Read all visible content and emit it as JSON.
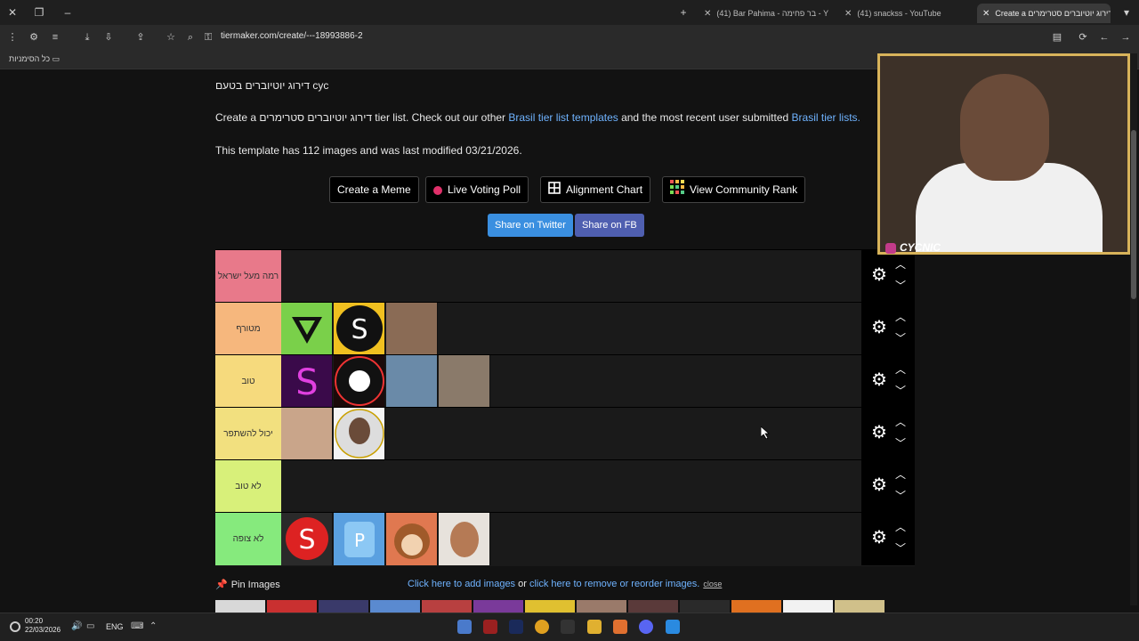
{
  "browser": {
    "tabs": [
      {
        "label": "(41) Bar Pahima - בר פחימה - Y",
        "active": false
      },
      {
        "label": "(41) snackss - YouTube",
        "active": false
      },
      {
        "label": "Create a דירוג יוטיוברים סטרימרים",
        "active": true
      }
    ],
    "url": "tiermaker.com/create/---18993886-2",
    "bookmarks_label": "כל הסימניות"
  },
  "page": {
    "title": "דירוג יוטיוברים בטעם cyc",
    "intro": {
      "prefix": "Create a דירוג יוטיוברים סטרימרים tier list. Check out our other ",
      "link1": "Brasil tier list templates",
      "middle": " and the most recent user submitted ",
      "link2": "Brasil tier lists."
    },
    "template_info": "This template has 112 images and was last modified 03/21/2026.",
    "buttons": {
      "meme": "Create a Meme",
      "poll": "Live Voting Poll",
      "alignment": "Alignment Chart",
      "community": "View Community Rank",
      "twitter": "Share on Twitter",
      "fb": "Share on FB"
    },
    "tiers": [
      {
        "label": "רמה מעל ישראל",
        "color": "#e8798a",
        "items": 0
      },
      {
        "label": "מטורף",
        "color": "#f6b77d",
        "items": 3
      },
      {
        "label": "טוב",
        "color": "#f6da7d",
        "items": 4
      },
      {
        "label": "יכול להשתפר",
        "color": "#f2e07f",
        "items": 2
      },
      {
        "label": "לא טוב",
        "color": "#d8f07a",
        "items": 0
      },
      {
        "label": "לא צופה",
        "color": "#86ea7d",
        "items": 4
      }
    ],
    "pin_images": "Pin Images",
    "add_images": "Click here to add images",
    "or": " or ",
    "reorder": "click here to remove or reorder images.",
    "close": "close"
  },
  "webcam": {
    "label": "CYCNIC"
  },
  "taskbar": {
    "time": "00:20",
    "date": "22/03/2026",
    "lang": "ENG"
  }
}
